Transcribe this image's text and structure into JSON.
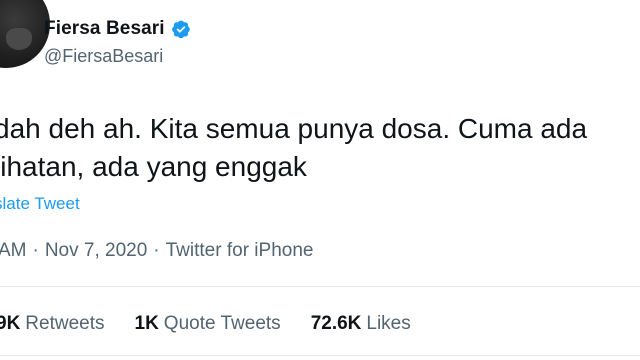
{
  "author": {
    "name": "Fiersa Besari",
    "handle": "@FiersaBesari",
    "verified_icon": "verified-badge-icon"
  },
  "tweet": {
    "text_line1": "dah deh ah. Kita semua punya dosa. Cuma ada",
    "text_line2": "lihatan, ada yang enggak",
    "translate_label": "slate Tweet"
  },
  "meta": {
    "time": "AM",
    "separator1": "·",
    "date": "Nov 7, 2020",
    "separator2": "·",
    "source": "Twitter for iPhone"
  },
  "stats": {
    "retweets_count": "9K",
    "retweets_label": "Retweets",
    "quotes_count": "1K",
    "quotes_label": "Quote Tweets",
    "likes_count": "72.6K",
    "likes_label": "Likes"
  },
  "colors": {
    "link_blue": "#1d9bf0",
    "muted_gray": "#536471",
    "text_dark": "#0f1419"
  }
}
